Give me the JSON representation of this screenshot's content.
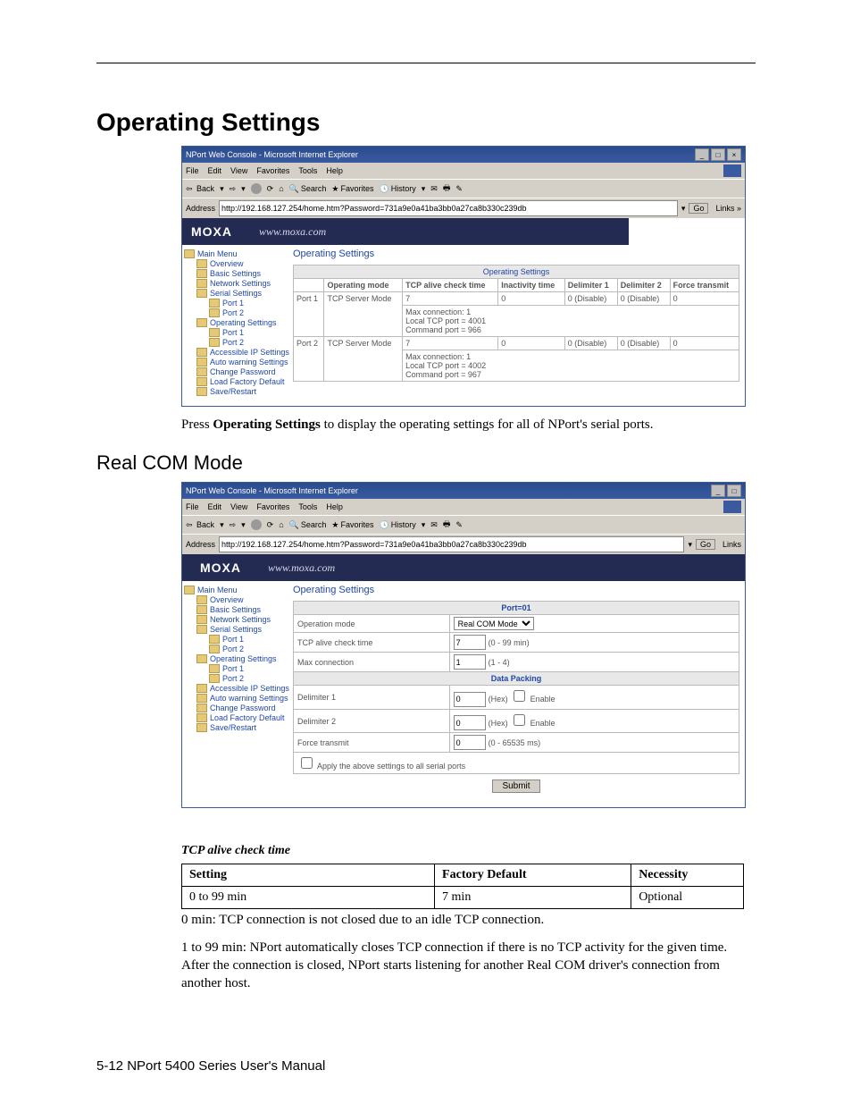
{
  "page": {
    "section_title": "Operating Settings",
    "subsection_title": "Real COM Mode",
    "footer": "5-12  NPort 5400 Series User's Manual"
  },
  "ie": {
    "title": "NPort Web Console - Microsoft Internet Explorer",
    "menus": [
      "File",
      "Edit",
      "View",
      "Favorites",
      "Tools",
      "Help"
    ],
    "toolbar": {
      "back": "Back",
      "search": "Search",
      "favorites": "Favorites",
      "history": "History"
    },
    "address_label": "Address",
    "address_value": "http://192.168.127.254/home.htm?Password=731a9e0a41ba3bb0a27ca8b330c239db",
    "go": "Go",
    "links": "Links"
  },
  "moxa": {
    "logo": "MOXA",
    "url": "www.moxa.com"
  },
  "nav": {
    "main": "Main Menu",
    "overview": "Overview",
    "basic": "Basic Settings",
    "network": "Network Settings",
    "serial": "Serial Settings",
    "port1": "Port 1",
    "port2": "Port 2",
    "operating": "Operating Settings",
    "accessible": "Accessible IP Settings",
    "auto_warning": "Auto warning Settings",
    "change_pw": "Change Password",
    "factory": "Load Factory Default",
    "save": "Save/Restart"
  },
  "console1": {
    "heading": "Operating Settings",
    "table_caption": "Operating Settings",
    "headers": {
      "mode": "Operating mode",
      "tcp_alive": "TCP alive check time",
      "inactivity": "Inactivity time",
      "delim1": "Delimiter 1",
      "delim2": "Delimiter 2",
      "force": "Force transmit"
    },
    "rows": [
      {
        "port": "Port 1",
        "mode": "TCP Server Mode",
        "tcp": "7",
        "inact": "0",
        "d1": "0 (Disable)",
        "d2": "0 (Disable)",
        "force": "0",
        "detail": "Max connection: 1\nLocal TCP port = 4001\nCommand port = 966"
      },
      {
        "port": "Port 2",
        "mode": "TCP Server Mode",
        "tcp": "7",
        "inact": "0",
        "d1": "0 (Disable)",
        "d2": "0 (Disable)",
        "force": "0",
        "detail": "Max connection: 1\nLocal TCP port = 4002\nCommand port = 967"
      }
    ]
  },
  "caption1": {
    "pre": "Press ",
    "bold": "Operating Settings",
    "post": " to display the operating settings for all of NPort's serial ports."
  },
  "console2": {
    "heading": "Operating Settings",
    "port_header": "Port=01",
    "labels": {
      "op_mode": "Operation mode",
      "op_mode_value": "Real COM Mode",
      "tcp_alive": "TCP alive check time",
      "tcp_alive_value": "7",
      "tcp_alive_range": "(0 - 99 min)",
      "max_conn": "Max connection",
      "max_conn_value": "1",
      "max_conn_range": "(1 - 4)",
      "packing_header": "Data Packing",
      "delim1": "Delimiter 1",
      "delim1_value": "0",
      "delim2": "Delimiter 2",
      "delim2_value": "0",
      "hex_enable": "(Hex)  Enable",
      "force": "Force transmit",
      "force_value": "0",
      "force_range": "(0 - 65535 ms)",
      "apply_all": "Apply the above settings to all serial ports",
      "submit": "Submit"
    }
  },
  "setting": {
    "name": "TCP alive check time",
    "headers": {
      "setting": "Setting",
      "default": "Factory Default",
      "necessity": "Necessity"
    },
    "row": {
      "range": "0 to 99 min",
      "default": "7 min",
      "necessity": "Optional"
    },
    "note_zero": "0 min: TCP connection is not closed due to an idle TCP connection.",
    "note_range": "1 to 99 min: NPort automatically closes TCP connection if there is no TCP activity for the given time. After the connection is closed, NPort starts listening for another Real COM driver's connection from another host."
  }
}
